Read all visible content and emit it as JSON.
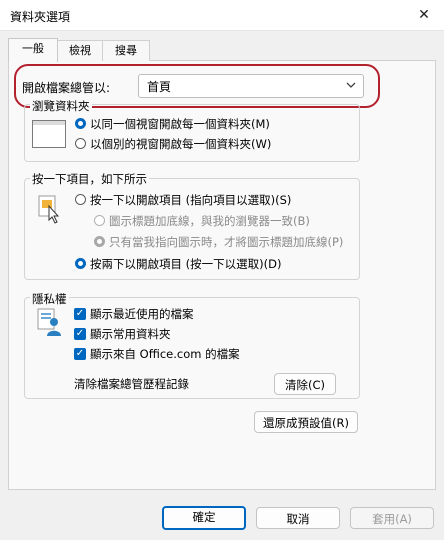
{
  "window": {
    "title": "資料夾選項",
    "close_glyph": "✕"
  },
  "tabs": [
    {
      "label": "一般"
    },
    {
      "label": "檢視"
    },
    {
      "label": "搜尋"
    }
  ],
  "navigation_pane": {
    "label": "開啟檔案總管以:",
    "selected": "首頁",
    "accent_color": "#b3202e"
  },
  "browse_folders": {
    "legend": "瀏覽資料夾",
    "options": [
      {
        "label": "以同一個視窗開啟每一個資料夾(M)",
        "selected": true
      },
      {
        "label": "以個別的視窗開啟每一個資料夾(W)",
        "selected": false
      }
    ]
  },
  "click_items": {
    "legend": "按一下項目，如下所示",
    "single_click": {
      "label": "按一下以開啟項目 (指向項目以選取)(S)",
      "selected": false
    },
    "sub_options": [
      {
        "label": "圖示標題加底線，與我的瀏覽器一致(B)",
        "selected": false,
        "disabled": true
      },
      {
        "label": "只有當我指向圖示時，才將圖示標題加底線(P)",
        "selected": true,
        "disabled": true
      }
    ],
    "double_click": {
      "label": "按兩下以開啟項目 (按一下以選取)(D)",
      "selected": true
    }
  },
  "privacy": {
    "legend": "隱私權",
    "checkboxes": [
      {
        "label": "顯示最近使用的檔案",
        "checked": true
      },
      {
        "label": "顯示常用資料夾",
        "checked": true
      },
      {
        "label": "顯示來自 Office.com 的檔案",
        "checked": true
      }
    ],
    "clear_label": "清除檔案總管歷程記錄",
    "clear_button": "清除(C)"
  },
  "restore_button": "還原成預設值(R)",
  "dialog_buttons": {
    "ok": "確定",
    "cancel": "取消",
    "apply": "套用(A)"
  },
  "colors": {
    "accent": "#0067c0",
    "highlight_border": "#b3202e"
  }
}
